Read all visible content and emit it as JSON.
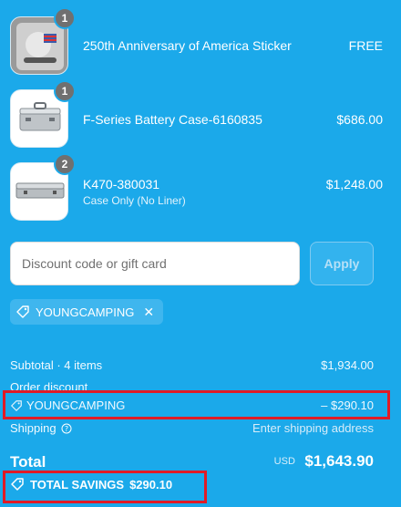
{
  "cart": {
    "items": [
      {
        "name": "250th Anniversary of America Sticker",
        "variant": "",
        "price": "FREE",
        "quantity": "1",
        "thumb_icon": "sticker-image"
      },
      {
        "name": "F-Series Battery Case-6160835",
        "variant": "",
        "price": "$686.00",
        "quantity": "1",
        "thumb_icon": "battery-case-image"
      },
      {
        "name": "K470-380031",
        "variant": "Case Only (No Liner)",
        "price": "$1,248.00",
        "quantity": "2",
        "thumb_icon": "case-image"
      }
    ]
  },
  "discount": {
    "placeholder": "Discount code or gift card",
    "apply_label": "Apply",
    "applied_code": "YOUNGCAMPING",
    "remove_icon": "close-icon"
  },
  "summary": {
    "subtotal_label": "Subtotal · 4 items",
    "subtotal_value": "$1,934.00",
    "order_discount_label": "Order discount",
    "discount_code": "YOUNGCAMPING",
    "discount_value": "– $290.10",
    "shipping_label": "Shipping",
    "shipping_value": "Enter shipping address",
    "total_label": "Total",
    "currency": "USD",
    "total_value": "$1,643.90",
    "savings_label": "TOTAL SAVINGS",
    "savings_value": "$290.10"
  },
  "colors": {
    "background": "#1ba9ea",
    "highlight_box": "#e01b26"
  }
}
